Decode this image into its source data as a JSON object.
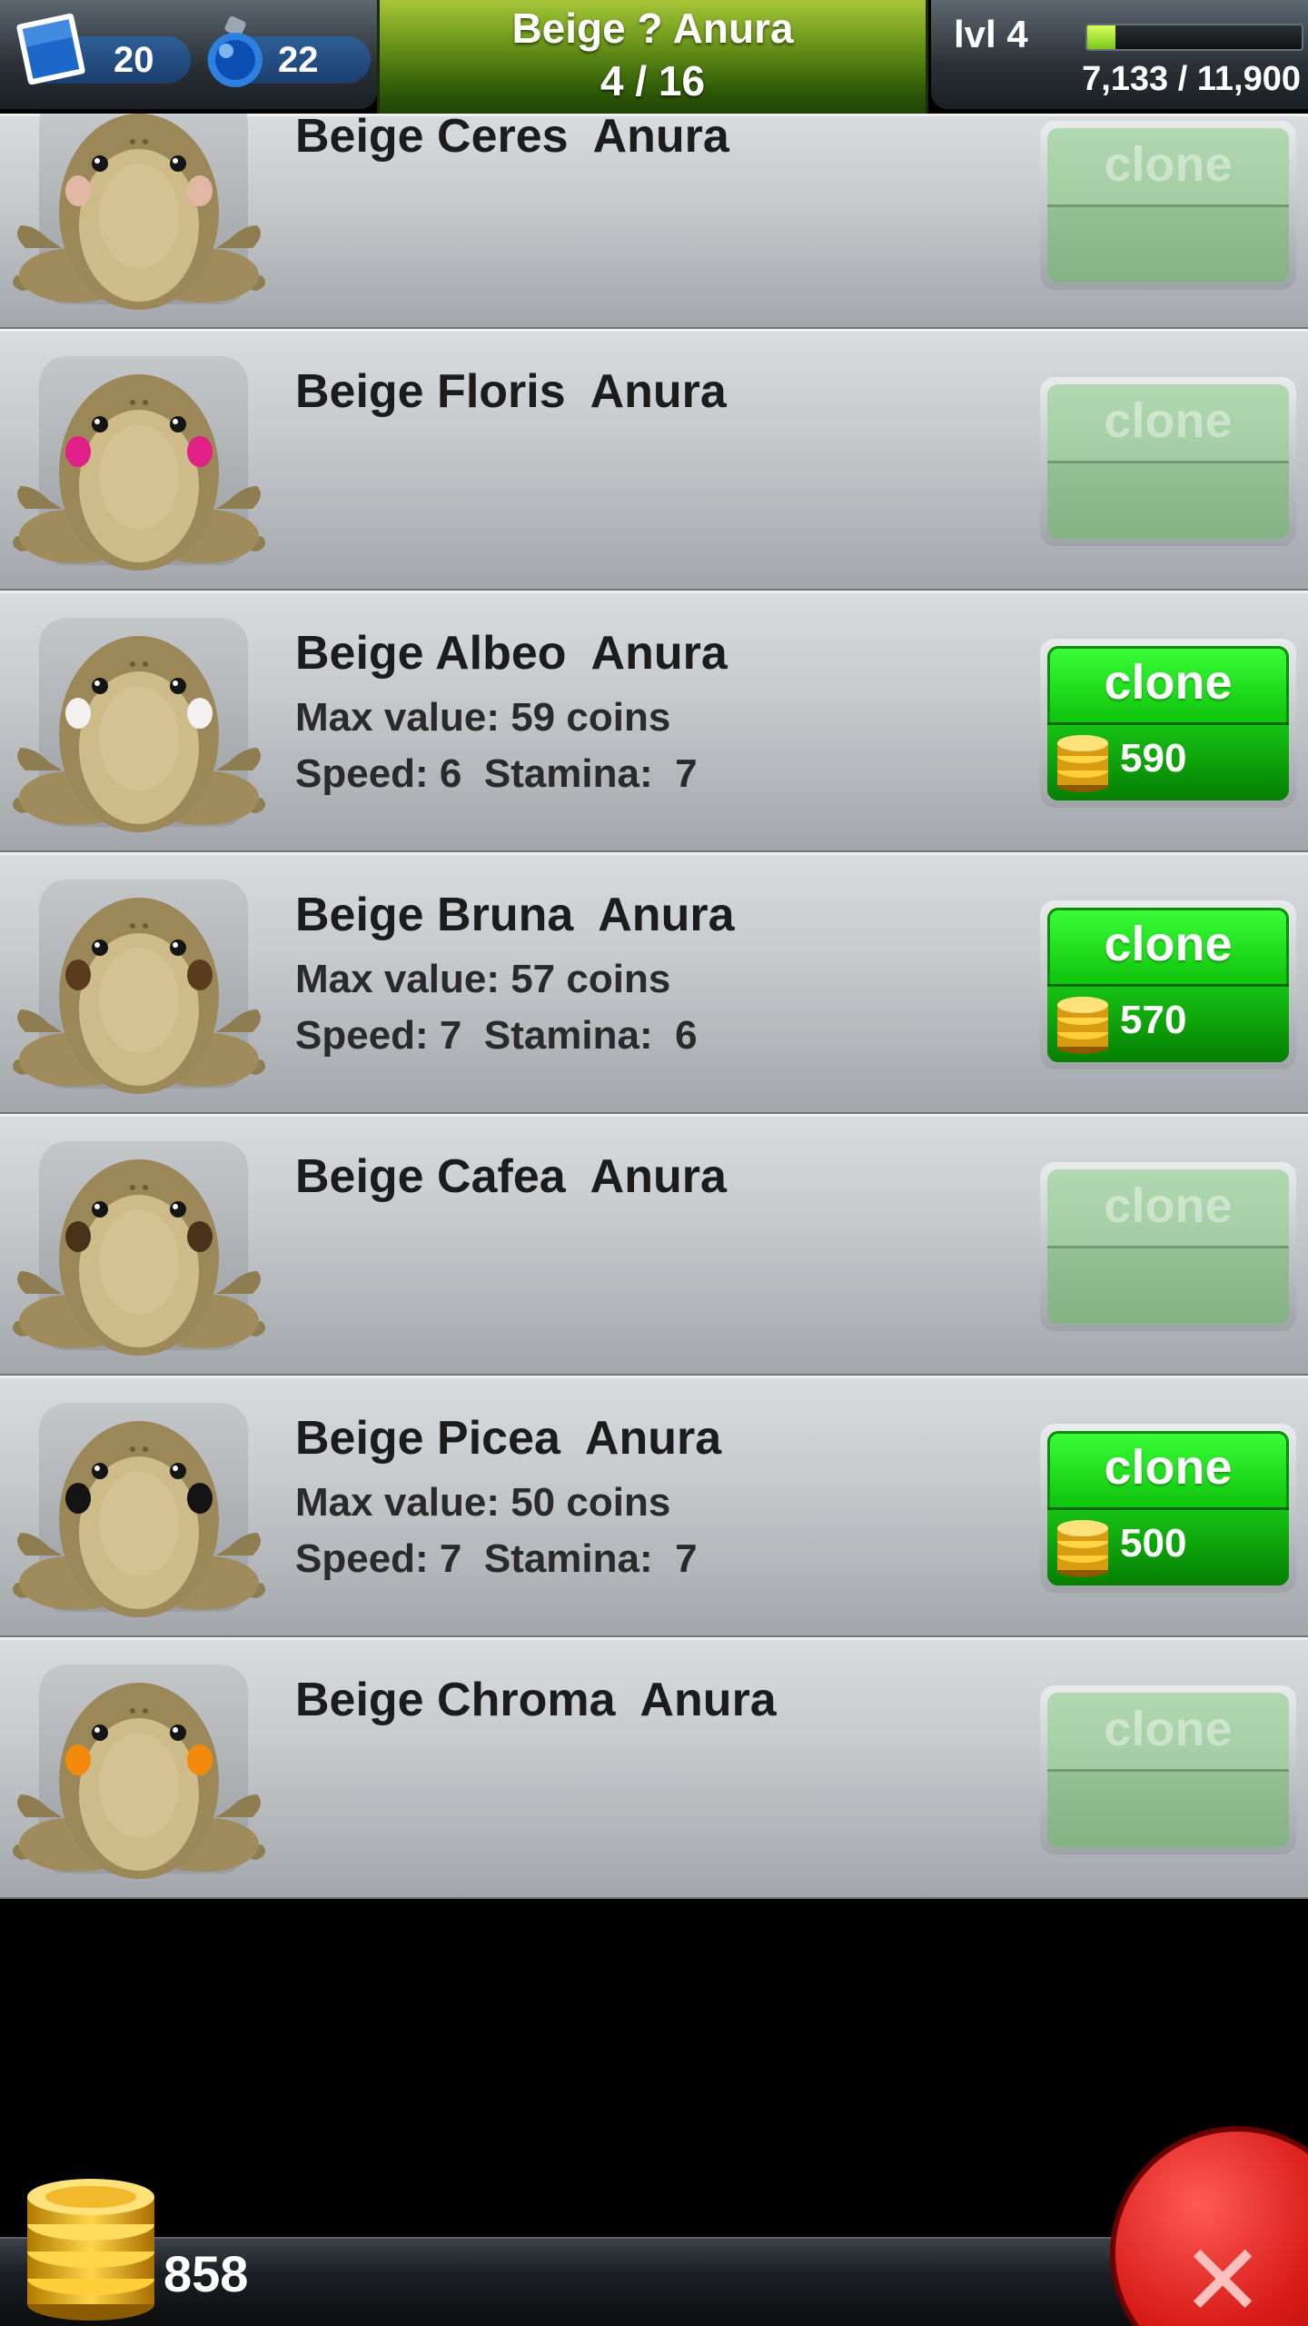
{
  "hud": {
    "stamps": "20",
    "potions": "22",
    "title": "Beige ? Anura",
    "count": "4 / 16",
    "level": "lvl 4",
    "xp": "7,133 / 11,900",
    "xp_fraction": 0.13
  },
  "frogs": [
    {
      "name": "Beige Ceres  Anura",
      "spot_color": "#e3b7a6",
      "unlocked": false
    },
    {
      "name": "Beige Floris  Anura",
      "spot_color": "#e21f86",
      "unlocked": false
    },
    {
      "name": "Beige Albeo  Anura",
      "spot_color": "#f2f1ef",
      "unlocked": true,
      "max_value": "Max value: 59 coins",
      "speed_stamina": "Speed: 6  Stamina:  7",
      "price": "590"
    },
    {
      "name": "Beige Bruna  Anura",
      "spot_color": "#5a3b1e",
      "unlocked": true,
      "max_value": "Max value: 57 coins",
      "speed_stamina": "Speed: 7  Stamina:  6",
      "price": "570"
    },
    {
      "name": "Beige Cafea  Anura",
      "spot_color": "#4a3119",
      "unlocked": false
    },
    {
      "name": "Beige Picea  Anura",
      "spot_color": "#141414",
      "unlocked": true,
      "max_value": "Max value: 50 coins",
      "speed_stamina": "Speed: 7  Stamina:  7",
      "price": "500"
    },
    {
      "name": "Beige Chroma  Anura",
      "spot_color": "#f28b0c",
      "unlocked": false
    }
  ],
  "clone_label": "clone",
  "footer": {
    "coins": "858",
    "close_label": "✕"
  },
  "icons": {
    "stamp": "stamp-icon",
    "potion": "potion-icon",
    "coin": "coin-icon",
    "close": "close-icon",
    "frog": "frog-icon"
  }
}
